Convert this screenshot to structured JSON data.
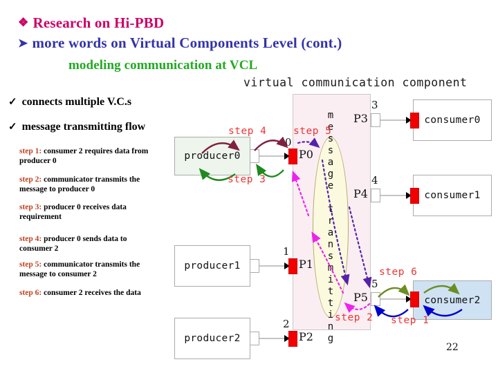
{
  "slide": {
    "page_number": "22",
    "title_bullet_1": {
      "glyph": "❖",
      "text": "Research on Hi-PBD",
      "color": "#cc0066"
    },
    "title_bullet_2": {
      "glyph": "➤",
      "text": "more words on Virtual Components Level (cont.)",
      "color": "#3333aa"
    },
    "subtitle": {
      "text": "modeling communication at VCL",
      "color": "#22aa22"
    },
    "checks": [
      {
        "glyph": "✓",
        "text": "connects multiple V.C.s"
      },
      {
        "glyph": "✓",
        "text": "message transmitting flow"
      }
    ],
    "steps": [
      {
        "label": "step 1:",
        "text": " consumer 2 requires data from producer 0"
      },
      {
        "label": "step 2:",
        "text": " communicator transmits the message to producer 0"
      },
      {
        "label": "step 3:",
        "text": " producer 0 receives data requirement"
      },
      {
        "label": "step 4:",
        "text": " producer 0 sends data to consumer 2"
      },
      {
        "label": "step 5:",
        "text": " communicator transmits the message to consumer 2"
      },
      {
        "label": "step 6:",
        "text": " consumer 2 receives the data"
      }
    ],
    "step_label_color": "#bb4422"
  },
  "diagram": {
    "vcc_title": "virtual communication component",
    "panel_color": "#fbeef3",
    "oval_label": "message transmitting",
    "oval_color": "#fbfadf",
    "port_color": "#f20000",
    "boxes": [
      {
        "name": "producer0",
        "label": "producer0",
        "fill": "#edf5ed"
      },
      {
        "name": "producer1",
        "label": "producer1",
        "fill": "#ffffff"
      },
      {
        "name": "producer2",
        "label": "producer2",
        "fill": "#ffffff"
      },
      {
        "name": "consumer0",
        "label": "consumer0",
        "fill": "#ffffff"
      },
      {
        "name": "consumer1",
        "label": "consumer1",
        "fill": "#ffffff"
      },
      {
        "name": "consumer2",
        "label": "consumer2",
        "fill": "#cfe2f3"
      }
    ],
    "ports": [
      {
        "id": "P0",
        "label": "P0",
        "number": "0"
      },
      {
        "id": "P1",
        "label": "P1",
        "number": "1"
      },
      {
        "id": "P2",
        "label": "P2",
        "number": "2"
      },
      {
        "id": "P3",
        "label": "P3",
        "number": "3"
      },
      {
        "id": "P4",
        "label": "P4",
        "number": "4"
      },
      {
        "id": "P5",
        "label": "P5",
        "number": "5"
      }
    ],
    "step_arrows": [
      {
        "id": "step1",
        "label": "step 1",
        "color": "#0000cc"
      },
      {
        "id": "step2",
        "label": "step 2",
        "color": "#cc33cc"
      },
      {
        "id": "step3",
        "label": "step 3",
        "color": "#008000"
      },
      {
        "id": "step4",
        "label": "step 4",
        "color": "#802040"
      },
      {
        "id": "step5",
        "label": "step 5",
        "color": "#5522aa"
      },
      {
        "id": "step6",
        "label": "step 6",
        "color": "#6b8e23"
      }
    ],
    "step_label_color": "#ee3333"
  }
}
